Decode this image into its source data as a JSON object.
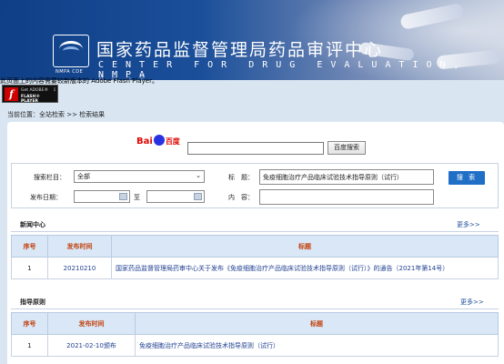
{
  "header": {
    "title_cn": "国家药品监督管理局药品审评中心",
    "title_en": "CENTER FOR DRUG EVALUATION, NMPA",
    "logo_text": "NMPA CDE"
  },
  "flash": {
    "notice": "此页面上的内容需要较新版本的 Adobe Flash Player。",
    "line1": "Get ADOBE®",
    "line2": "FLASH® PLAYER"
  },
  "breadcrumb": "当前位置：全站检索 >> 检索结果",
  "baidu": {
    "brand_bai": "Bai",
    "brand_du": "百度",
    "button": "百度搜索",
    "input_value": ""
  },
  "search_form": {
    "column_label": "搜索栏目：",
    "column_value": "全部",
    "title_label": "标　题：",
    "title_value": "免疫细胞治疗产品临床试验技术指导原则（试行）",
    "date_label": "发布日期：",
    "date_to": "至",
    "content_label": "内　容：",
    "search_button": "搜 索"
  },
  "news": {
    "title": "新闻中心",
    "more": "更多>>",
    "headers": [
      "序号",
      "发布时间",
      "标题"
    ],
    "rows": [
      [
        "1",
        "20210210",
        "国家药品监督管理局药审中心关于发布《免疫细胞治疗产品临床试验技术指导原则（试行）》的通告（2021年第14号）"
      ]
    ]
  },
  "guidance": {
    "title": "指导原则",
    "more": "更多>>",
    "headers": [
      "序号",
      "发布时间",
      "标题"
    ],
    "rows": [
      [
        "1",
        "2021-02-10颁布",
        "免疫细胞治疗产品临床试验技术指导原则（试行）"
      ]
    ]
  }
}
